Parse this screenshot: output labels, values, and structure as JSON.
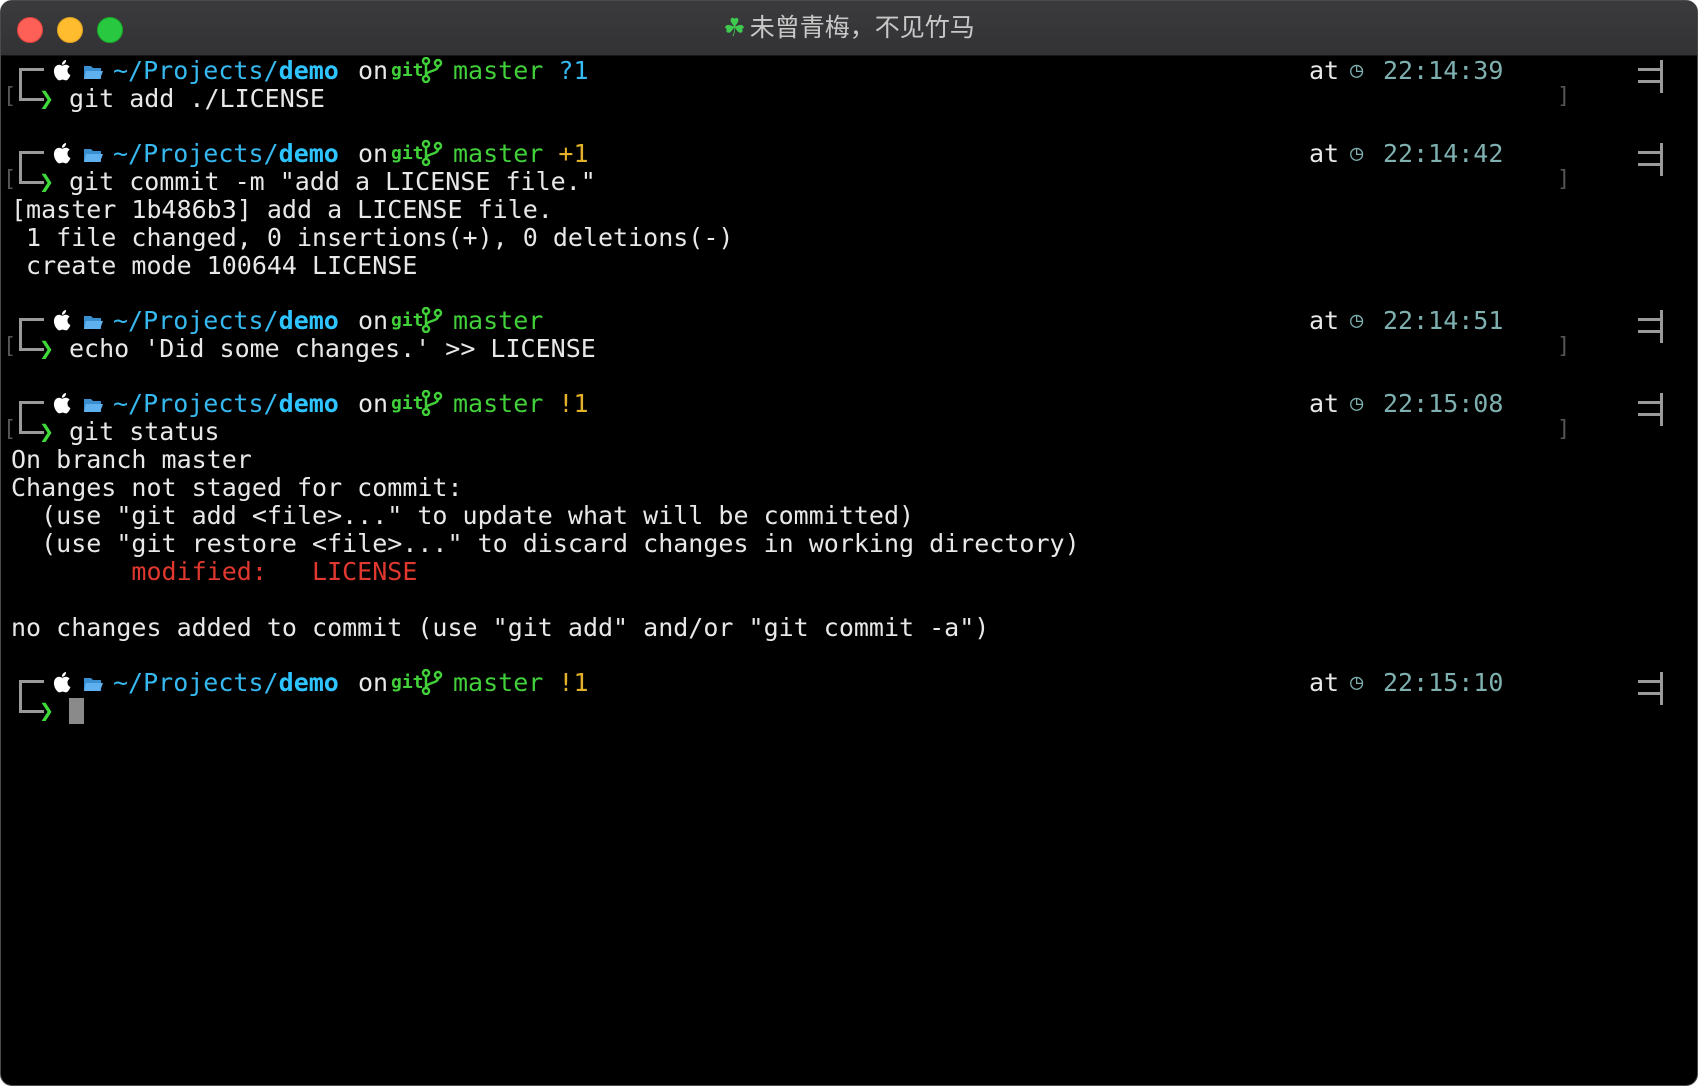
{
  "window": {
    "title": "未曾青梅，不见竹马",
    "title_icon": "☘"
  },
  "prompt_parts": {
    "apple": "",
    "folder": "",
    "path_prefix": "~/Projects/",
    "path_dir": "demo",
    "on": "on",
    "git_logo": "git",
    "branch_icon": "",
    "branch": "master",
    "at": "at",
    "clock": "◷",
    "chevron": "❯"
  },
  "blocks": [
    {
      "status": "?1",
      "status_color": "blue",
      "time": "22:14:39",
      "command": "git add ./LICENSE",
      "output": []
    },
    {
      "status": "+1",
      "status_color": "yellow",
      "time": "22:14:42",
      "command": "git commit -m \"add a LICENSE file.\"",
      "output": [
        "[master 1b486b3] add a LICENSE file.",
        " 1 file changed, 0 insertions(+), 0 deletions(-)",
        " create mode 100644 LICENSE"
      ]
    },
    {
      "status": "",
      "status_color": "none",
      "time": "22:14:51",
      "command": "echo 'Did some changes.' >> LICENSE",
      "output": []
    },
    {
      "status": "!1",
      "status_color": "yellow",
      "time": "22:15:08",
      "command": "git status",
      "output": [
        "On branch master",
        "Changes not staged for commit:",
        "  (use \"git add <file>...\" to update what will be committed)",
        "  (use \"git restore <file>...\" to discard changes in working directory)"
      ],
      "modified_label": "        modified:   ",
      "modified_file": "LICENSE",
      "output_after": [
        "",
        "no changes added to commit (use \"git add\" and/or \"git commit -a\")"
      ]
    },
    {
      "status": "!1",
      "status_color": "yellow",
      "time": "22:15:10",
      "command": "",
      "output": []
    }
  ],
  "colors": {
    "path": "#36b9f0",
    "branch": "#42d03a",
    "status_yellow": "#e3b12a",
    "status_blue": "#36b9f0",
    "modified": "#e0382f",
    "time": "#7fb0b0"
  }
}
